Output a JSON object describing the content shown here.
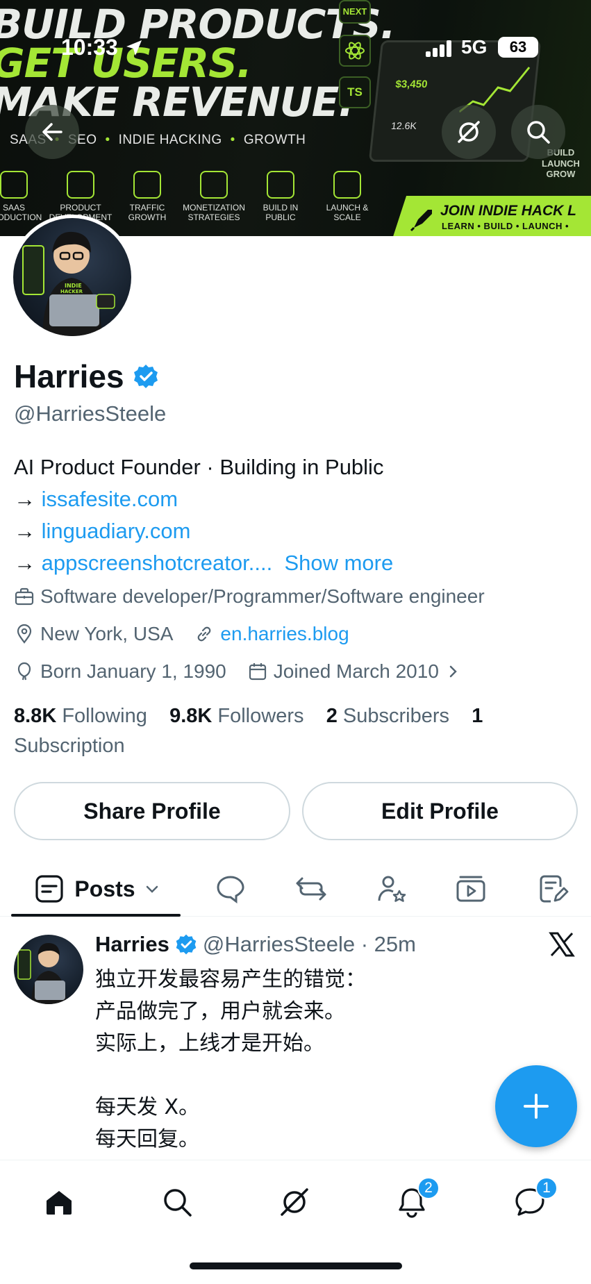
{
  "status_bar": {
    "time": "10:33",
    "network": "5G",
    "battery": "63"
  },
  "banner": {
    "headline": [
      "BUILD PRODUCTS.",
      "GET USERS.",
      "MAKE REVENUE."
    ],
    "tags": [
      "SAAS",
      "SEO",
      "INDIE HACKING",
      "GROWTH"
    ],
    "icons": [
      "SAAS PRODUCTION",
      "PRODUCT DEVELOPMENT",
      "TRAFFIC GROWTH",
      "MONETIZATION STRATEGIES",
      "BUILD IN PUBLIC",
      "LAUNCH & SCALE"
    ],
    "tech": [
      "NEXT",
      "TS"
    ],
    "laptop_revenue": "$3,450",
    "laptop_users": "12.6K",
    "side_text": [
      "BUILD",
      "LAUNCH",
      "GROW"
    ],
    "join_title": "JOIN INDIE HACK L",
    "join_sub": "LEARN • BUILD • LAUNCH •",
    "accent": "#a4e635"
  },
  "profile": {
    "name": "Harries",
    "handle": "@HarriesSteele",
    "bio_lines": [
      {
        "text": "AI Product Founder · Building in Public"
      },
      {
        "prefix": "→ ",
        "link": "issafesite.com"
      },
      {
        "prefix": "→ ",
        "link": "linguadiary.com"
      },
      {
        "prefix": "→ ",
        "link": "appscreenshotcreator....",
        "more": "Show more"
      }
    ],
    "category": "Software developer/Programmer/Software engineer",
    "location": "New York, USA",
    "website": "en.harries.blog",
    "born": "Born January 1, 1990",
    "joined": "Joined March 2010",
    "stats": {
      "following_count": "8.8K",
      "following_label": "Following",
      "followers_count": "9.8K",
      "followers_label": "Followers",
      "subscribers_count": "2",
      "subscribers_label": "Subscribers",
      "subscription_count": "1",
      "subscription_label": "Subscription"
    }
  },
  "buttons": {
    "share": "Share Profile",
    "edit": "Edit Profile"
  },
  "tabs": {
    "posts": "Posts"
  },
  "post": {
    "name": "Harries",
    "handle_time": "@HarriesSteele · 25m",
    "lines": [
      "独立开发最容易产生的错觉：",
      "产品做完了，用户就会来。",
      "实际上，上线才是开始。",
      "",
      "每天发 X。",
      "每天回复。"
    ]
  },
  "nav": {
    "notifications_badge": "2",
    "messages_badge": "1"
  },
  "colors": {
    "link": "#1d9bf0",
    "text": "#0f1419",
    "secondary": "#536471"
  }
}
